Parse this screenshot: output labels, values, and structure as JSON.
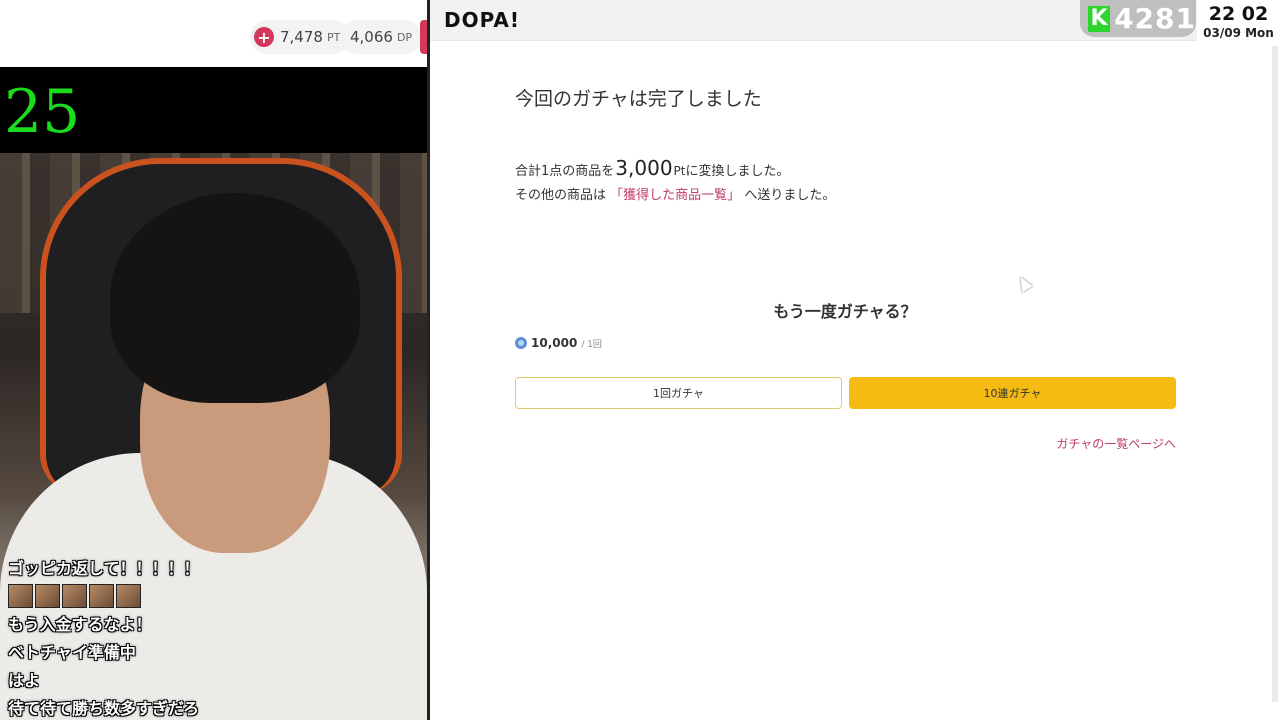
{
  "stream": {
    "points": {
      "value": "7,478",
      "unit": "PT"
    },
    "dp": {
      "value": "4,066",
      "unit": "DP"
    },
    "counter": "25",
    "chat": [
      "ゴッピカ返して！！！！！",
      "もう入金するなよ！",
      "ベトチャイ準備中",
      "はよ",
      "待て待て勝ち数多すぎだろ"
    ]
  },
  "page": {
    "logo": "DOPA!",
    "done_title": "今回のガチャは完了しました",
    "converted_prefix": "合計1点の商品を",
    "converted_amount": "3,000",
    "converted_unit": "Pt",
    "converted_suffix": "に変換しました。",
    "sent_prefix": "その他の商品は",
    "acquired_link": "「獲得した商品一覧」",
    "sent_suffix": "へ送りました。",
    "again_title": "もう一度ガチャる？",
    "price": "10,000",
    "per_label": "/ 1回",
    "btn_single": "1回ガチャ",
    "btn_ten": "10連ガチャ",
    "list_link": "ガチャの一覧ページへ",
    "colors": {
      "accent": "#c0396a",
      "button": "#f5bb12"
    }
  },
  "overlay": {
    "viewer_icon": "K",
    "viewer_count": "4281",
    "clock_time": "22 02",
    "clock_date": "03/09 Mon"
  }
}
